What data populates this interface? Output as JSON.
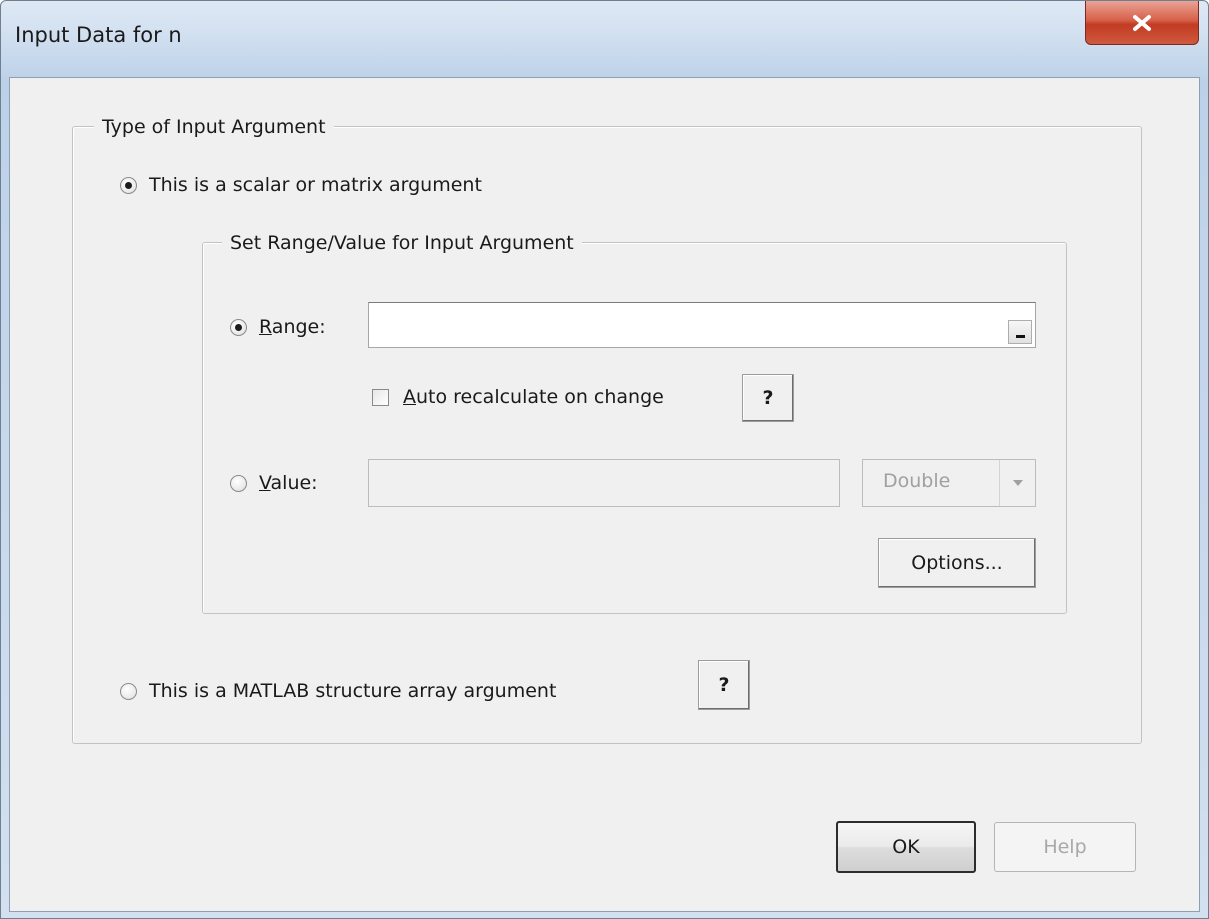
{
  "window": {
    "title": "Input Data for n",
    "close_label": "x"
  },
  "type_group": {
    "legend": "Type of Input Argument",
    "scalar_radio_label": "This is a scalar or matrix argument",
    "struct_radio_label": "This is a MATLAB structure array argument",
    "struct_help_label": "?"
  },
  "range_group": {
    "legend": "Set Range/Value for Input Argument",
    "range_radio_prefix": "R",
    "range_radio_rest": "ange:",
    "range_value": "",
    "auto_recalc_prefix": "A",
    "auto_recalc_rest": "uto recalculate on change",
    "auto_recalc_help_label": "?",
    "value_radio_prefix": "V",
    "value_radio_rest": "alue:",
    "value_value": "",
    "type_combo_value": "Double",
    "options_label": "Options..."
  },
  "buttons": {
    "ok_label": "OK",
    "help_label": "Help"
  },
  "state": {
    "scalar_selected": true,
    "range_selected": true,
    "auto_recalc_checked": false
  }
}
